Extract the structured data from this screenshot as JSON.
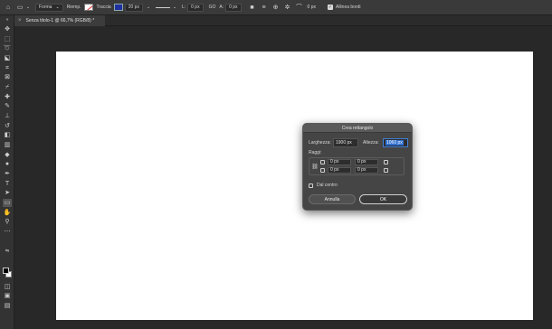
{
  "options_bar": {
    "tool_mode": "Forma",
    "fill_label": "Riemp.",
    "stroke_label": "Traccia",
    "stroke_width": "20 px",
    "w_label": "L:",
    "w_value": "0 px",
    "link_label": "GO",
    "h_label": "A:",
    "h_value": "0 px",
    "radius_value": "0 px",
    "align_edges_label": "Allinea bordi",
    "align_edges_checked": true
  },
  "document_tab": {
    "title": "Senza titolo-1 @ 66,7% (RGB/8) *"
  },
  "dialog": {
    "title": "Crea rettangolo",
    "width_label": "Larghezza:",
    "width_value": "1900 px",
    "height_label": "Altezza:",
    "height_value": "1060 px",
    "radii_label": "Raggi:",
    "radii": {
      "top_left": "0 px",
      "top_right": "0 px",
      "bottom_left": "0 px",
      "bottom_right": "0 px"
    },
    "from_center_label": "Dal centro",
    "cancel_label": "Annulla",
    "ok_label": "OK"
  },
  "colors": {
    "background": "#282828",
    "panel": "#333333",
    "canvas": "#ffffff",
    "dialog": "#454545",
    "selection": "#2f6fd0"
  }
}
